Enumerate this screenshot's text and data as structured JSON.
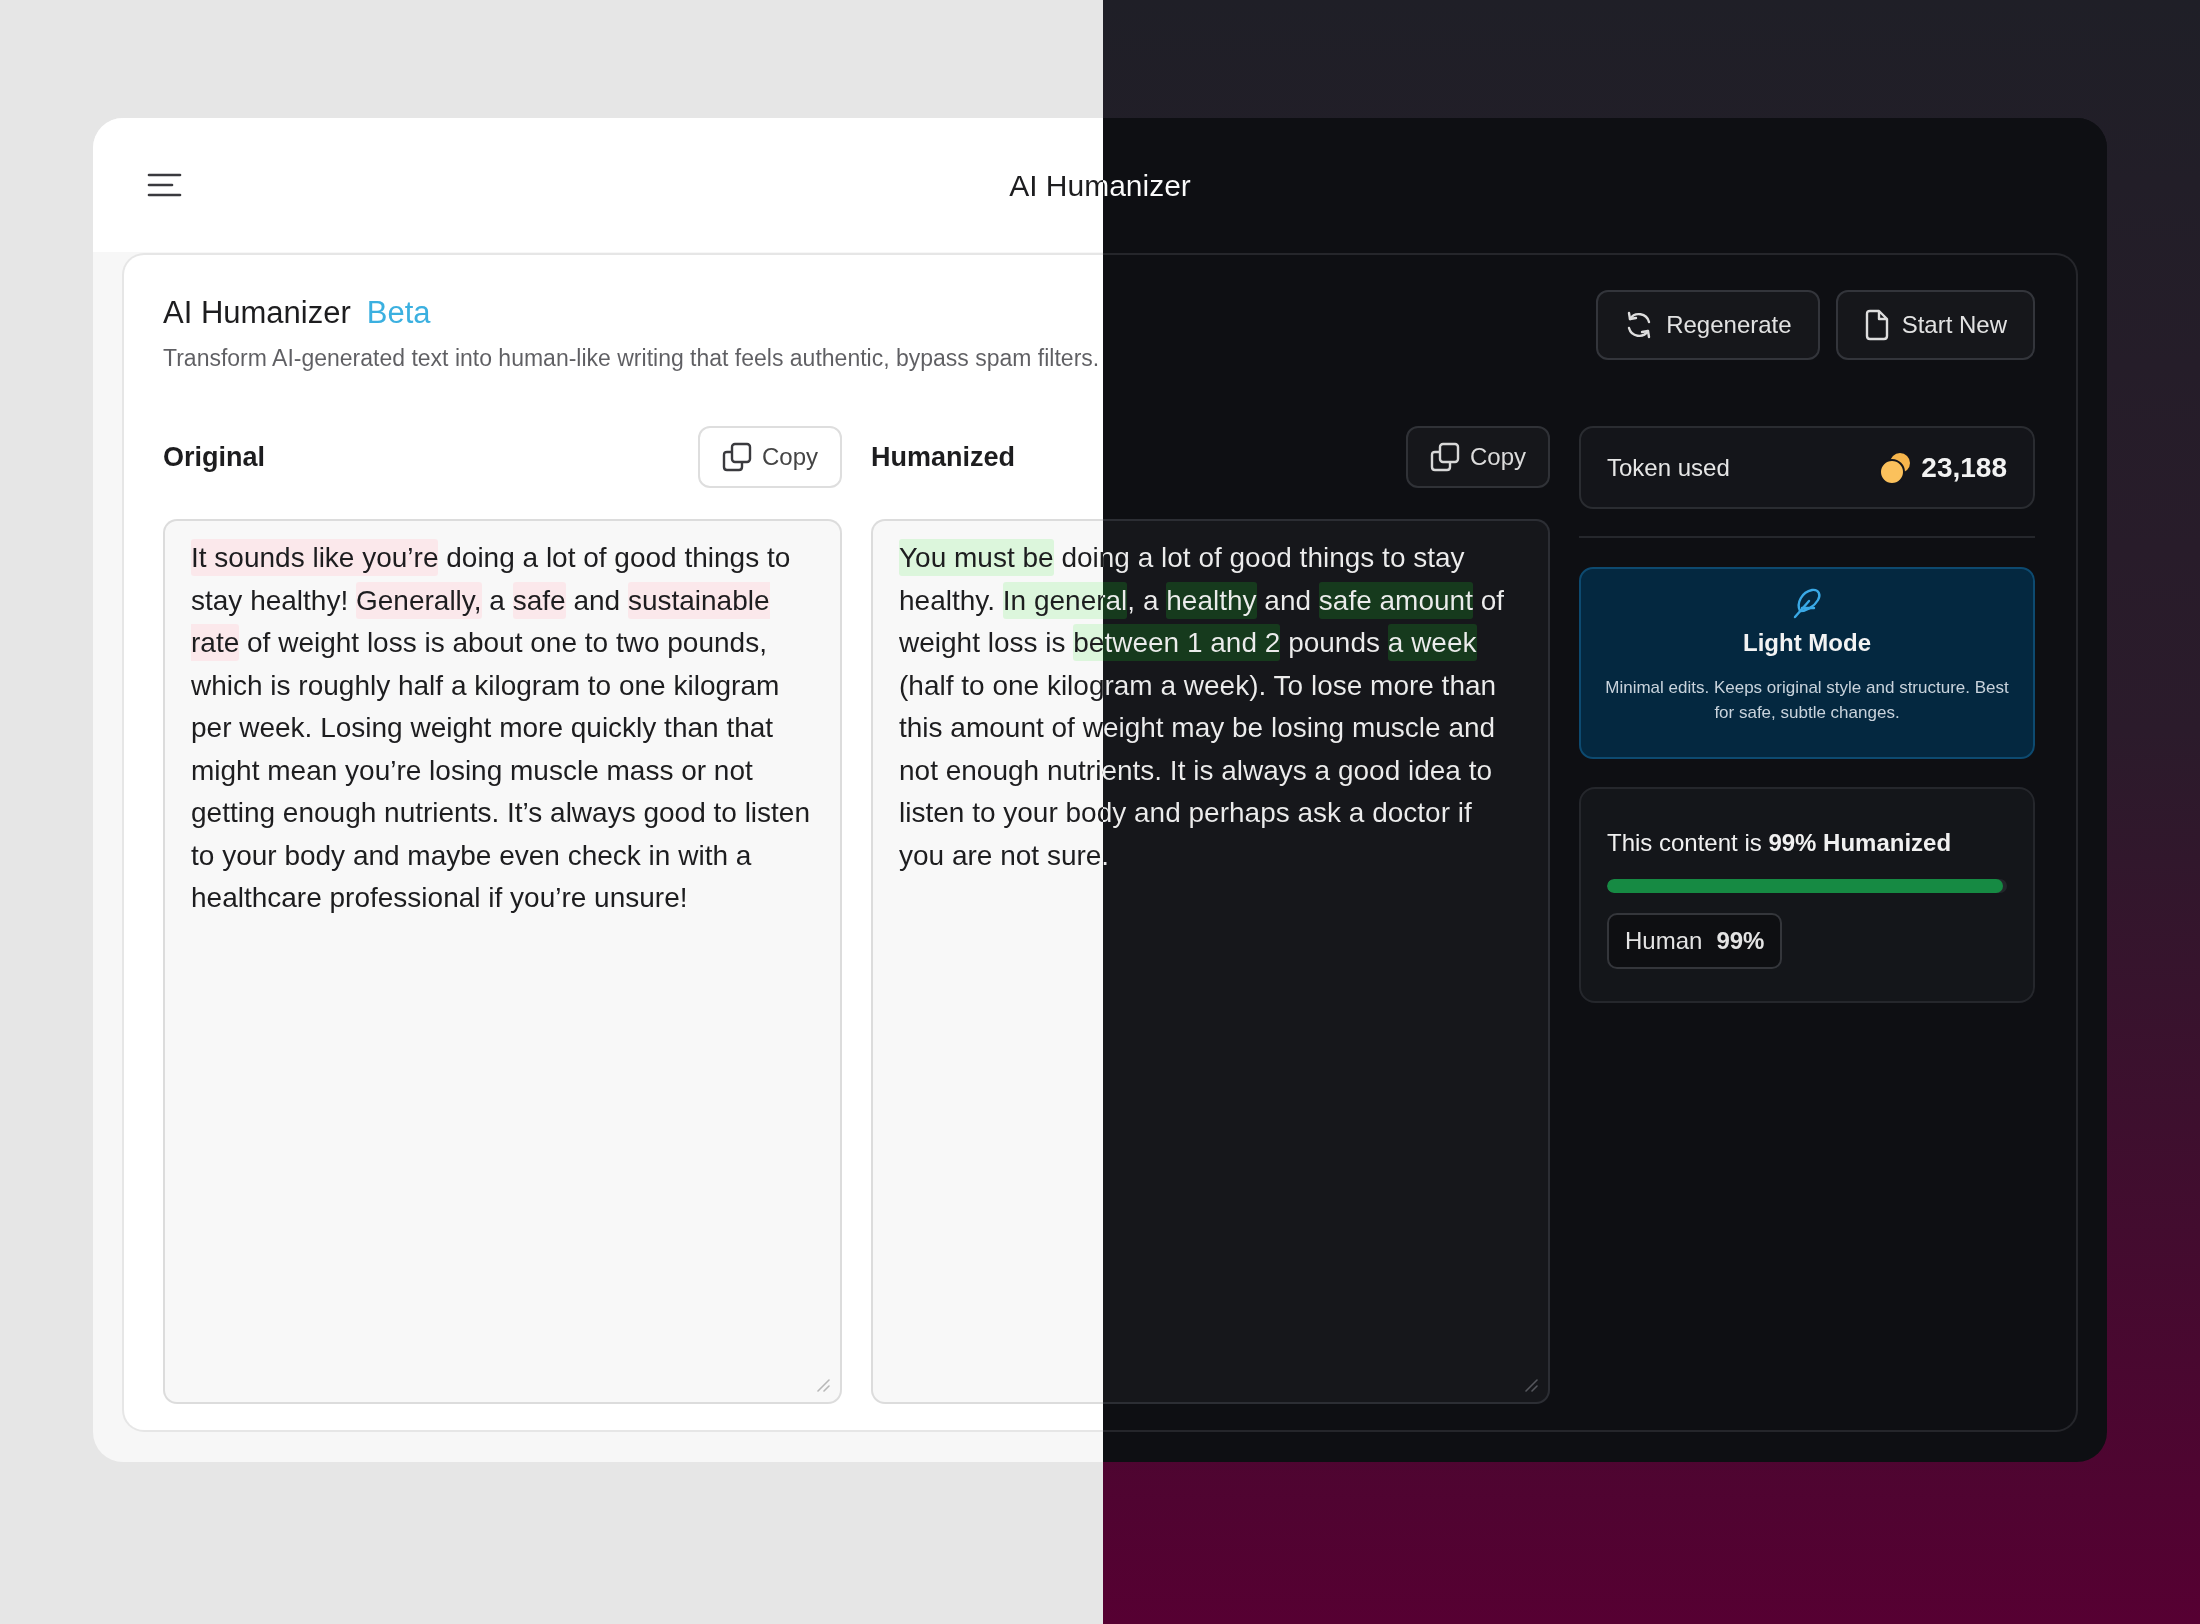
{
  "header": {
    "title": "AI Humanizer"
  },
  "intro": {
    "title": "AI Humanizer",
    "badge": "Beta",
    "subtitle": "Transform AI-generated text into human-like writing that feels authentic, bypass spam filters."
  },
  "actions": [
    {
      "label": "Regenerate",
      "kind": "regenerate"
    },
    {
      "label": "Start New",
      "kind": "new"
    }
  ],
  "panels": [
    {
      "label": "Original",
      "copy": "Copy",
      "kind": "removed",
      "segments": [
        {
          "text": "It sounds like you’re",
          "highlighted": true
        },
        {
          "text": " doing a lot of good things to stay healthy! ",
          "highlighted": false
        },
        {
          "text": "Generally,",
          "highlighted": true
        },
        {
          "text": " a ",
          "highlighted": false
        },
        {
          "text": "safe",
          "highlighted": true
        },
        {
          "text": " and ",
          "highlighted": false
        },
        {
          "text": "sustainable rate",
          "highlighted": true
        },
        {
          "text": " of weight loss is about one to two pounds, which is roughly half a kilogram to one kilogram per week. Losing weight more quickly than that might mean you’re losing muscle mass or not getting enough nutrients. It’s always good to listen to your body and maybe even check in with a healthcare professional if you’re unsure!",
          "highlighted": false
        }
      ]
    },
    {
      "label": "Humanized",
      "copy": "Copy",
      "kind": "added",
      "segments": [
        {
          "text": "You must be",
          "highlighted": true
        },
        {
          "text": " doing a lot of good things to stay healthy. ",
          "highlighted": false
        },
        {
          "text": "In general",
          "highlighted": true
        },
        {
          "text": ", a ",
          "highlighted": false
        },
        {
          "text": "healthy",
          "highlighted": true
        },
        {
          "text": " and ",
          "highlighted": false
        },
        {
          "text": "safe amount",
          "highlighted": true
        },
        {
          "text": " of weight loss is ",
          "highlighted": false
        },
        {
          "text": "between 1 and 2",
          "highlighted": true
        },
        {
          "text": " pounds ",
          "highlighted": false
        },
        {
          "text": "a week",
          "highlighted": true
        },
        {
          "text": " (half to one kilogram a week). To lose more than this amount of weight may be losing muscle and not enough nutrients. It is always a good idea to listen to your body and perhaps ask a doctor if you are not sure.",
          "highlighted": false
        }
      ]
    }
  ],
  "tokens": {
    "label": "Token used",
    "value": "23,188"
  },
  "mode": {
    "title": "Light Mode",
    "description": "Minimal edits. Keeps original style and structure. Best for safe, subtle changes.",
    "selected": true
  },
  "score": {
    "text": "This content is **99% Humanized**",
    "level": 0.99,
    "tag_label": "Human",
    "tag_value": "99%"
  }
}
